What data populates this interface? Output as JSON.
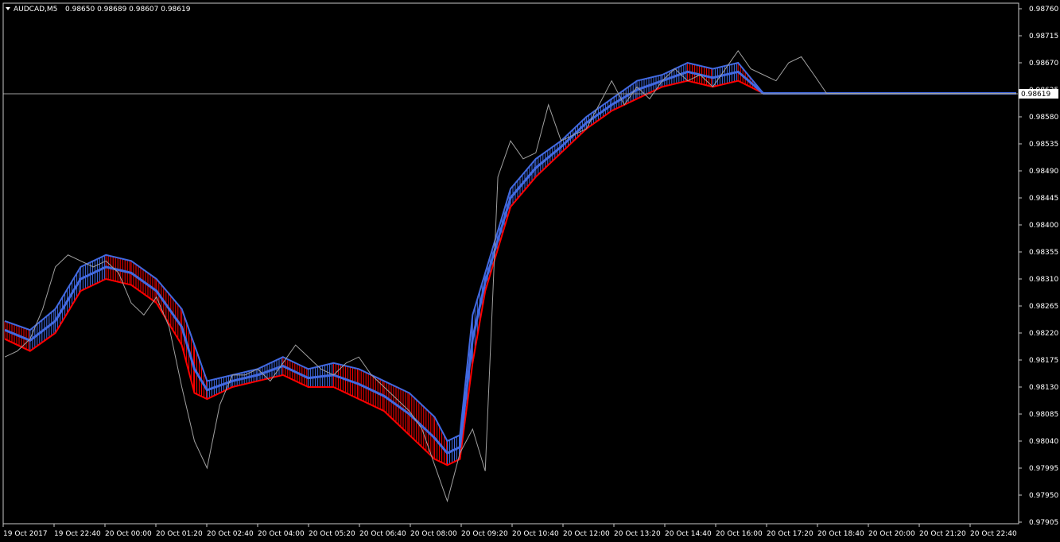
{
  "header": {
    "symbol": "AUDCAD,M5",
    "ohlc": "0.98650 0.98689 0.98607 0.98619"
  },
  "colors": {
    "background": "#000000",
    "axis": "#c8c8c8",
    "price_line": "#a0a0a0",
    "band_up": "#4169e1",
    "band_down": "#ff0000",
    "current_price_label_bg": "#ffffff",
    "current_price_label_text": "#000000"
  },
  "chart_data": {
    "type": "line",
    "symbol": "AUDCAD",
    "timeframe": "M5",
    "current_price": 0.98619,
    "ylim": [
      0.97905,
      0.9876
    ],
    "y_ticks": [
      "0.98760",
      "0.98715",
      "0.98670",
      "0.98625",
      "0.98580",
      "0.98535",
      "0.98490",
      "0.98445",
      "0.98400",
      "0.98355",
      "0.98310",
      "0.98265",
      "0.98220",
      "0.98175",
      "0.98130",
      "0.98085",
      "0.98040",
      "0.97995",
      "0.97950",
      "0.97905"
    ],
    "x_ticks": [
      "19 Oct 2017",
      "19 Oct 22:40",
      "20 Oct 00:00",
      "20 Oct 01:20",
      "20 Oct 02:40",
      "20 Oct 04:00",
      "20 Oct 05:20",
      "20 Oct 06:40",
      "20 Oct 08:00",
      "20 Oct 09:20",
      "20 Oct 10:40",
      "20 Oct 12:00",
      "20 Oct 13:20",
      "20 Oct 14:40",
      "20 Oct 16:00",
      "20 Oct 17:20",
      "20 Oct 18:40",
      "20 Oct 20:00",
      "20 Oct 21:20",
      "20 Oct 22:40"
    ],
    "series": [
      {
        "x_index": [
          0,
          4,
          8,
          12,
          16,
          20,
          24,
          28,
          32,
          36,
          40,
          44,
          48,
          52,
          56,
          60,
          64,
          68,
          72,
          76,
          80,
          84,
          88,
          92,
          96,
          100,
          104,
          108,
          112,
          116,
          120,
          124,
          128,
          132,
          136,
          140,
          144,
          148,
          152,
          156,
          160,
          164,
          168,
          172,
          176,
          180,
          184,
          188,
          192,
          196,
          200,
          204,
          208,
          212,
          216,
          220,
          224,
          228,
          232,
          236,
          240,
          244,
          248,
          252,
          256,
          260,
          264,
          268,
          272,
          276,
          280,
          284,
          288,
          292,
          296,
          300,
          304,
          308,
          312,
          316,
          320
        ],
        "values": [
          0.9818,
          0.9819,
          0.9821,
          0.9826,
          0.9833,
          0.9835,
          0.9834,
          0.9833,
          0.9834,
          0.9832,
          0.9827,
          0.9825,
          0.9828,
          0.9823,
          0.9813,
          0.9804,
          0.97995,
          0.981,
          0.9815,
          0.9815,
          0.9816,
          0.9814,
          0.9817,
          0.982,
          0.9818,
          0.9816,
          0.9815,
          0.9817,
          0.9818,
          0.9815,
          0.9813,
          0.9811,
          0.9809,
          0.9806,
          0.98,
          0.9794,
          0.9802,
          0.9806,
          0.9799,
          0.9848,
          0.9854,
          0.9851,
          0.9852,
          0.986,
          0.9854,
          0.9855,
          0.9856,
          0.986,
          0.9864,
          0.986,
          0.9863,
          0.9861,
          0.9864,
          0.9866,
          0.9864,
          0.9865,
          0.9863,
          0.9866,
          0.9869,
          0.9866,
          0.9865,
          0.9864,
          0.9867,
          0.9868,
          0.9865,
          0.98619,
          0.98619,
          0.98619,
          0.98619,
          0.98619,
          0.98619,
          0.98619,
          0.98619,
          0.98619,
          0.98619,
          0.98619,
          0.98619,
          0.98619,
          0.98619,
          0.98619,
          0.98619
        ]
      },
      {
        "x_index": [
          0,
          8,
          16,
          24,
          32,
          40,
          48,
          56,
          60,
          64,
          72,
          80,
          88,
          96,
          104,
          112,
          120,
          128,
          136,
          140,
          144,
          148,
          152,
          160,
          168,
          176,
          184,
          192,
          200,
          208,
          216,
          224,
          232,
          240,
          248,
          256,
          264,
          272,
          280,
          288,
          296,
          304,
          312,
          320
        ],
        "upper": [
          0.9824,
          0.98225,
          0.9826,
          0.9833,
          0.9835,
          0.9834,
          0.9831,
          0.9826,
          0.982,
          0.9814,
          0.9815,
          0.9816,
          0.9818,
          0.9816,
          0.9817,
          0.9816,
          0.9814,
          0.9812,
          0.9808,
          0.9804,
          0.9805,
          0.9825,
          0.9832,
          0.9846,
          0.9851,
          0.9854,
          0.9858,
          0.9861,
          0.9864,
          0.9865,
          0.9867,
          0.9866,
          0.9867,
          0.98619,
          0.98619,
          0.98619,
          0.98619,
          0.98619,
          0.98619,
          0.98619,
          0.98619,
          0.98619,
          0.98619,
          0.98619
        ],
        "lower": [
          0.9821,
          0.9819,
          0.9822,
          0.9829,
          0.9831,
          0.983,
          0.9827,
          0.982,
          0.9812,
          0.9811,
          0.9813,
          0.9814,
          0.9815,
          0.9813,
          0.9813,
          0.9811,
          0.9809,
          0.9805,
          0.9801,
          0.98,
          0.9801,
          0.9817,
          0.9829,
          0.9843,
          0.9848,
          0.9852,
          0.9856,
          0.9859,
          0.9861,
          0.9863,
          0.9864,
          0.9863,
          0.9864,
          0.98619,
          0.98619,
          0.98619,
          0.98619,
          0.98619,
          0.98619,
          0.98619,
          0.98619,
          0.98619,
          0.98619,
          0.98619
        ]
      }
    ],
    "grid": false
  }
}
